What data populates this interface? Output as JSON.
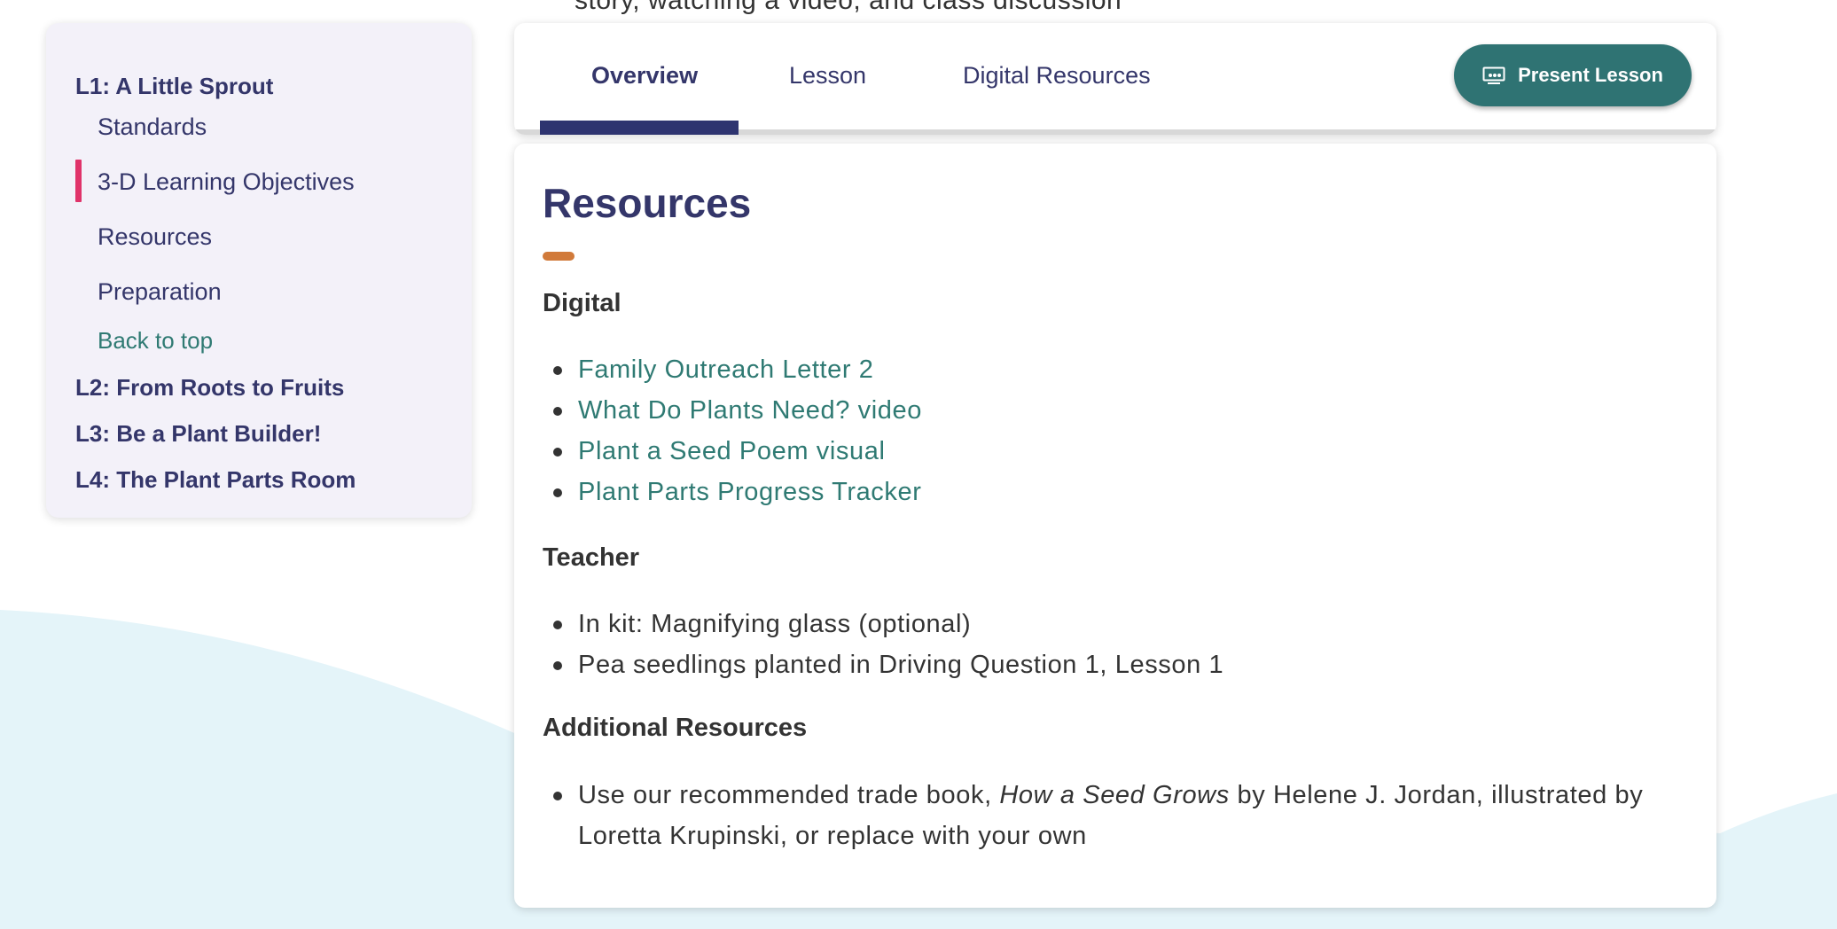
{
  "top_text": "story, watching a video, and class discussion",
  "sidebar": {
    "current_lesson": "L1: A Little Sprout",
    "sub_items": [
      {
        "label": "Standards"
      },
      {
        "label": "3-D Learning Objectives"
      },
      {
        "label": "Resources"
      },
      {
        "label": "Preparation"
      }
    ],
    "back_to_top": "Back to top",
    "lessons": [
      {
        "label": "L2: From Roots to Fruits"
      },
      {
        "label": "L3: Be a Plant Builder!"
      },
      {
        "label": "L4: The Plant Parts Room"
      }
    ]
  },
  "tabs": [
    {
      "label": "Overview",
      "active": true
    },
    {
      "label": "Lesson",
      "active": false
    },
    {
      "label": "Digital Resources",
      "active": false
    }
  ],
  "present_button": {
    "label": "Present Lesson",
    "icon": "presentation-icon"
  },
  "content": {
    "title": "Resources",
    "digital": {
      "heading": "Digital",
      "links": [
        "Family Outreach Letter 2",
        "What Do Plants Need? video",
        "Plant a Seed Poem visual",
        "Plant Parts Progress Tracker"
      ]
    },
    "teacher": {
      "heading": "Teacher",
      "items": [
        "In kit: Magnifying glass (optional)",
        "Pea seedlings planted in Driving Question 1, Lesson 1"
      ]
    },
    "additional": {
      "heading": "Additional Resources",
      "item_prefix": "Use our recommended trade book, ",
      "item_title": "How a Seed Grows",
      "item_suffix": " by Helene J. Jordan, illustrated by Loretta Krupinski, or replace with your own"
    }
  },
  "colors": {
    "navy": "#34366a",
    "teal": "#2f7373",
    "link_teal": "#2f7a73",
    "accent_pink": "#e0336a",
    "accent_orange": "#d17a3a",
    "wave": "#e4f4f9"
  }
}
